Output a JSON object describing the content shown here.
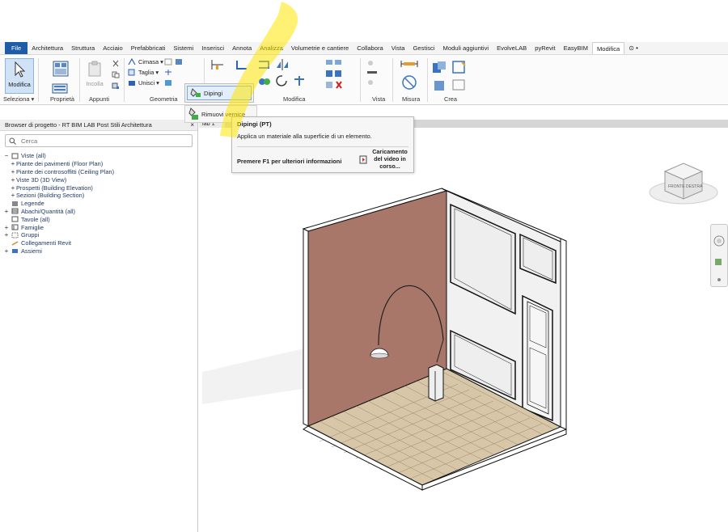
{
  "menu": {
    "tabs": [
      "File",
      "Architettura",
      "Struttura",
      "Acciaio",
      "Prefabbricati",
      "Sistemi",
      "Inserisci",
      "Annota",
      "Analizza",
      "Volumetrie e cantiere",
      "Collabora",
      "Vista",
      "Gestisci",
      "Moduli aggiuntivi",
      "EvolveLAB",
      "pyRevit",
      "EasyBIM",
      "Modifica"
    ],
    "active_tab": "Modifica",
    "extra_glyph": "⊙ •"
  },
  "ribbon": {
    "modifica_label": "Modifica",
    "seleziona_label": "Seleziona ▾",
    "proprieta_label": "Proprietà",
    "appunti_label": "Appunti",
    "incolla_label": "Incolla",
    "geometria_label": "Geometria",
    "modifica_panel_label": "Modifica",
    "vista_label": "Vista",
    "misura_label": "Misura",
    "crea_label": "Crea",
    "cimasa_label": "Cimasa ▾",
    "taglia_label": "Taglia ▾",
    "unisci_label": "Unisci ▾",
    "analizza_small": "Analizza"
  },
  "flyout": {
    "dipingi_label": "Dipingi",
    "rimuovi_label": "Rimuovi vernice"
  },
  "tooltip": {
    "title": "Dipingi (PT)",
    "description": "Applica un materiale alla superficie di un elemento.",
    "f1_text": "Premere F1 per ulteriori informazioni",
    "video_text": "Caricamento del video in corso..."
  },
  "browser": {
    "title": "Browser di progetto - RT BIM LAB Post Stili Architettura",
    "close_glyph": "×",
    "search_placeholder": "Cerca",
    "items": [
      {
        "toggle": "−",
        "label": "Viste (all)",
        "level": 0
      },
      {
        "toggle": "+",
        "label": "Piante dei pavimenti (Floor Plan)",
        "level": 1
      },
      {
        "toggle": "+",
        "label": "Piante dei controsoffitti (Ceiling Plan)",
        "level": 1
      },
      {
        "toggle": "+",
        "label": "Viste 3D (3D View)",
        "level": 1
      },
      {
        "toggle": "+",
        "label": "Prospetti (Building Elevation)",
        "level": 1
      },
      {
        "toggle": "+",
        "label": "Sezioni (Building Section)",
        "level": 1
      },
      {
        "toggle": "",
        "label": "Legende",
        "level": 0
      },
      {
        "toggle": "+",
        "label": "Abachi/Quantità (all)",
        "level": 0
      },
      {
        "toggle": "",
        "label": "Tavole (all)",
        "level": 0
      },
      {
        "toggle": "+",
        "label": "Famiglie",
        "level": 0
      },
      {
        "toggle": "+",
        "label": "Gruppi",
        "level": 0
      },
      {
        "toggle": "",
        "label": "Collegamenti Revit",
        "level": 0
      },
      {
        "toggle": "+",
        "label": "Assiemi",
        "level": 0
      }
    ]
  },
  "view": {
    "tab_label": "lab 1",
    "viewcube_right": "DESTRA",
    "viewcube_front": "FRONTE"
  },
  "colors": {
    "file_tab": "#1f5ca8",
    "wall_left": "#a8776a",
    "wall_right": "#eeeeee",
    "floor": "#d7c6a8",
    "highlight": "#ffe600"
  }
}
